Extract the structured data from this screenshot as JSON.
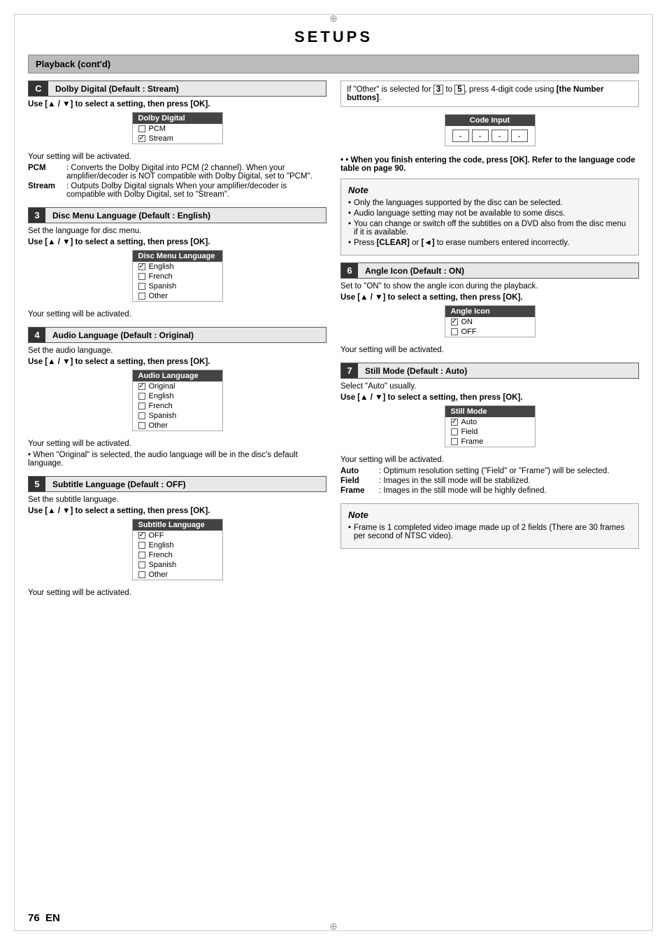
{
  "page": {
    "title": "SETUPS",
    "section_header": "Playback (cont'd)",
    "footer_page": "76",
    "footer_lang": "EN"
  },
  "block_c": {
    "letter": "C",
    "title": "Dolby Digital (Default : Stream)",
    "instruction": "Use [▲ / ▼] to select a setting, then press [OK].",
    "dropdown_header": "Dolby Digital",
    "options": [
      {
        "label": "PCM",
        "checked": false
      },
      {
        "label": "Stream",
        "checked": true
      }
    ],
    "activated": "Your setting will be activated.",
    "desc_pcm_label": "PCM",
    "desc_pcm_text": ": Converts the Dolby Digital into PCM (2 channel). When your amplifier/decoder is NOT compatible with Dolby Digital, set to \"PCM\".",
    "desc_stream_label": "Stream",
    "desc_stream_text": ": Outputs Dolby Digital signals When your amplifier/decoder is compatible with Dolby Digital, set to \"Stream\"."
  },
  "block_3": {
    "num": "3",
    "title": "Disc Menu Language (Default : English)",
    "desc": "Set the language for disc menu.",
    "instruction": "Use [▲ / ▼] to select a setting, then press [OK].",
    "dropdown_header": "Disc Menu Language",
    "options": [
      {
        "label": "English",
        "checked": true
      },
      {
        "label": "French",
        "checked": false
      },
      {
        "label": "Spanish",
        "checked": false
      },
      {
        "label": "Other",
        "checked": false
      }
    ],
    "activated": "Your setting will be activated."
  },
  "block_4": {
    "num": "4",
    "title": "Audio Language (Default : Original)",
    "desc": "Set the audio language.",
    "instruction": "Use [▲ / ▼] to select a setting, then press [OK].",
    "dropdown_header": "Audio Language",
    "options": [
      {
        "label": "Original",
        "checked": true
      },
      {
        "label": "English",
        "checked": false
      },
      {
        "label": "French",
        "checked": false
      },
      {
        "label": "Spanish",
        "checked": false
      },
      {
        "label": "Other",
        "checked": false
      }
    ],
    "activated": "Your setting will be activated.",
    "note": "• When \"Original\" is selected, the audio language will be in the disc's default language."
  },
  "block_5": {
    "num": "5",
    "title": "Subtitle Language (Default : OFF)",
    "desc": "Set the subtitle language.",
    "instruction": "Use [▲ / ▼] to select a setting, then press [OK].",
    "dropdown_header": "Subtitle Language",
    "options": [
      {
        "label": "OFF",
        "checked": true
      },
      {
        "label": "English",
        "checked": false
      },
      {
        "label": "French",
        "checked": false
      },
      {
        "label": "Spanish",
        "checked": false
      },
      {
        "label": "Other",
        "checked": false
      }
    ],
    "activated": "Your setting will be activated."
  },
  "right_intro": {
    "text": "If \"Other\" is selected for",
    "num_start": "3",
    "to": "to",
    "num_end": "5",
    "text2": ", press 4-digit code using",
    "bold_part": "[the Number buttons]",
    "text3": "."
  },
  "code_input": {
    "header": "Code Input",
    "fields": [
      "-",
      "-",
      "-",
      "-"
    ]
  },
  "enter_code_note": "• When you finish entering the code, press [OK]. Refer to the language code table on page 90.",
  "note_box": {
    "title": "Note",
    "items": [
      "Only the languages supported by the disc can be selected.",
      "Audio language setting may not be available to some discs.",
      "You can change or switch off the subtitles on a DVD also from the disc menu if it is available.",
      "Press [CLEAR] or [◄] to erase numbers entered incorrectly."
    ]
  },
  "block_6": {
    "num": "6",
    "title": "Angle Icon (Default : ON)",
    "desc": "Set to \"ON\" to show the angle icon during the playback.",
    "instruction": "Use [▲ / ▼] to select a setting, then press [OK].",
    "dropdown_header": "Angle Icon",
    "options": [
      {
        "label": "ON",
        "checked": true
      },
      {
        "label": "OFF",
        "checked": false
      }
    ],
    "activated": "Your setting will be activated."
  },
  "block_7": {
    "num": "7",
    "title": "Still Mode (Default : Auto)",
    "desc": "Select \"Auto\" usually.",
    "instruction": "Use [▲ / ▼] to select a setting, then press [OK].",
    "dropdown_header": "Still Mode",
    "options": [
      {
        "label": "Auto",
        "checked": true
      },
      {
        "label": "Field",
        "checked": false
      },
      {
        "label": "Frame",
        "checked": false
      }
    ],
    "activated": "Your setting will be activated.",
    "desc_auto_label": "Auto",
    "desc_auto_text": ": Optimum resolution setting (\"Field\" or \"Frame\") will be selected.",
    "desc_field_label": "Field",
    "desc_field_text": ": Images in the still mode will be stabilized.",
    "desc_frame_label": "Frame",
    "desc_frame_text": ": Images in the still mode will be highly defined."
  },
  "note_box_7": {
    "title": "Note",
    "items": [
      "Frame is 1 completed video image made up of 2 fields (There are 30 frames per second of NTSC video)."
    ]
  }
}
